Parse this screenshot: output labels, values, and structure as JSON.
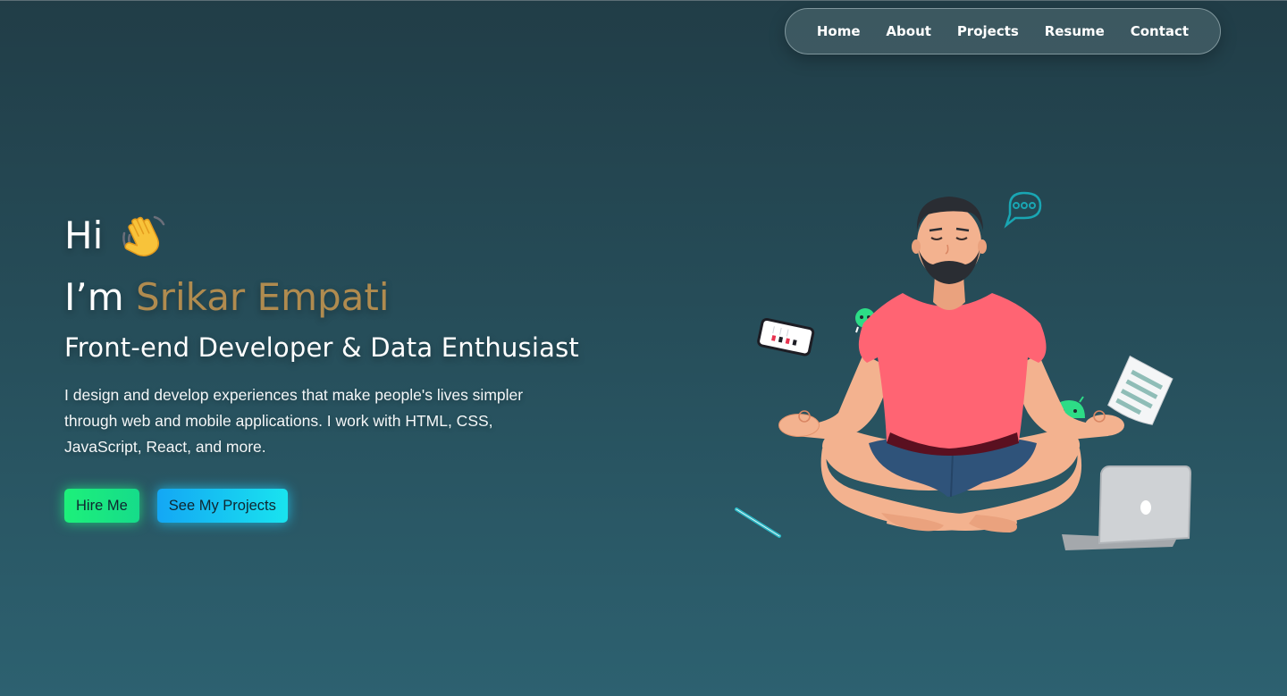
{
  "nav": {
    "items": [
      {
        "label": "Home"
      },
      {
        "label": "About"
      },
      {
        "label": "Projects"
      },
      {
        "label": "Resume"
      },
      {
        "label": "Contact"
      }
    ]
  },
  "hero": {
    "greeting": "Hi",
    "wave_icon": "waving-hand-icon",
    "name_prefix": "I’m ",
    "name": "Srikar Empati",
    "role": "Front-end Developer & Data Enthusiast",
    "intro": "I design and develop experiences that make people's lives simpler through web and mobile applications. I work with HTML, CSS, JavaScript, React, and more.",
    "buttons": {
      "hire_label": "Hire Me",
      "projects_label": "See My Projects"
    }
  },
  "illustration": {
    "icon": "meditating-developer-illustration"
  },
  "colors": {
    "background_top": "#213d47",
    "background_bottom": "#2d6170",
    "name_accent": "#b08b4f",
    "hire_button": "#1df07a",
    "projects_button": "#14a7f4",
    "shirt": "#ff6473"
  }
}
